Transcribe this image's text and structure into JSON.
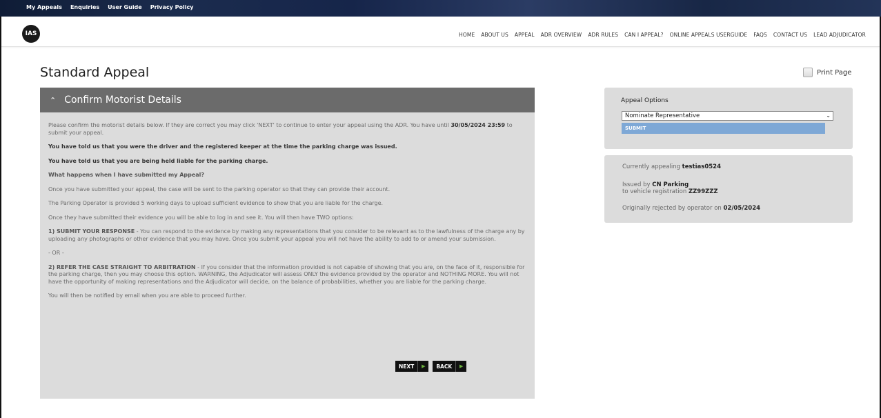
{
  "top_links": [
    "My Appeals",
    "Enquiries",
    "User Guide",
    "Privacy Policy"
  ],
  "logo_text": "IAS",
  "nav": [
    "HOME",
    "ABOUT US",
    "APPEAL",
    "ADR OVERVIEW",
    "ADR RULES",
    "CAN I APPEAL?",
    "ONLINE APPEALS USERGUIDE",
    "FAQS",
    "CONTACT US",
    "LEAD ADJUDICATOR"
  ],
  "page_title": "Standard Appeal",
  "print_label": "Print Page",
  "panel": {
    "title": "Confirm Motorist Details",
    "intro_pre": "Please confirm the motorist details below. If they are correct you may click 'NEXT' to continue to enter your appeal using the ADR. You have until ",
    "deadline": "30/05/2024 23:59",
    "intro_post": " to submit your appeal.",
    "told_driver": "You have told us that you were the driver and the registered keeper at the time the parking charge was issued.",
    "told_liable": "You have told us that you are being held liable for the parking charge.",
    "what_happens": "What happens when I have submitted my Appeal?",
    "p_submitted": "Once you have submitted your appeal, the case will be sent to the parking operator so that they can provide their account.",
    "p_operator": "The Parking Operator is provided 5 working days to upload sufficient evidence to show that you are liable for the charge.",
    "p_options": "Once they have submitted their evidence you will be able to log in and see it. You will then have TWO options:",
    "opt1_title": "1) SUBMIT YOUR RESPONSE",
    "opt1_text": " - You can respond to the evidence by making any representations that you consider to be relevant as to the lawfulness of the charge any by uploading any photographs or other evidence that you may have. Once you submit your appeal you will not have the ability to add to or amend your submission.",
    "or_text": "- OR -",
    "opt2_title": "2) REFER THE CASE STRAIGHT TO ARBITRATION",
    "opt2_text": " - If you consider that the information provided is not capable of showing that you are, on the face of it, responsible for the parking charge, then you may choose this option. WARNING, the Adjudicator will assess ONLY the evidence provided by the operator and NOTHING MORE. You will not have the opportunity of making representations and the Adjudicator will decide, on the balance of probabilities, whether you are liable for the parking charge.",
    "p_notify": "You will then be notified by email when you are able to proceed further.",
    "next_label": "NEXT",
    "back_label": "BACK"
  },
  "options": {
    "heading": "Appeal Options",
    "selected": "Nominate Representative",
    "submit_label": "SUBMIT"
  },
  "info": {
    "appealing_pre": "Currently appealing ",
    "appealing_ref": "testias0524",
    "issued_pre": "Issued by ",
    "issuer": "CN Parking",
    "vehicle_pre": "to vehicle registration ",
    "registration": "ZZ99ZZZ",
    "rejected_pre": "Originally rejected by operator on ",
    "rejected_date": "02/05/2024"
  },
  "colors": {
    "panel_bg": "#dcdcdc",
    "panel_header": "#6b6b6b",
    "submit_bg": "#7ea8d6",
    "button_arrow": "#6db33f"
  }
}
